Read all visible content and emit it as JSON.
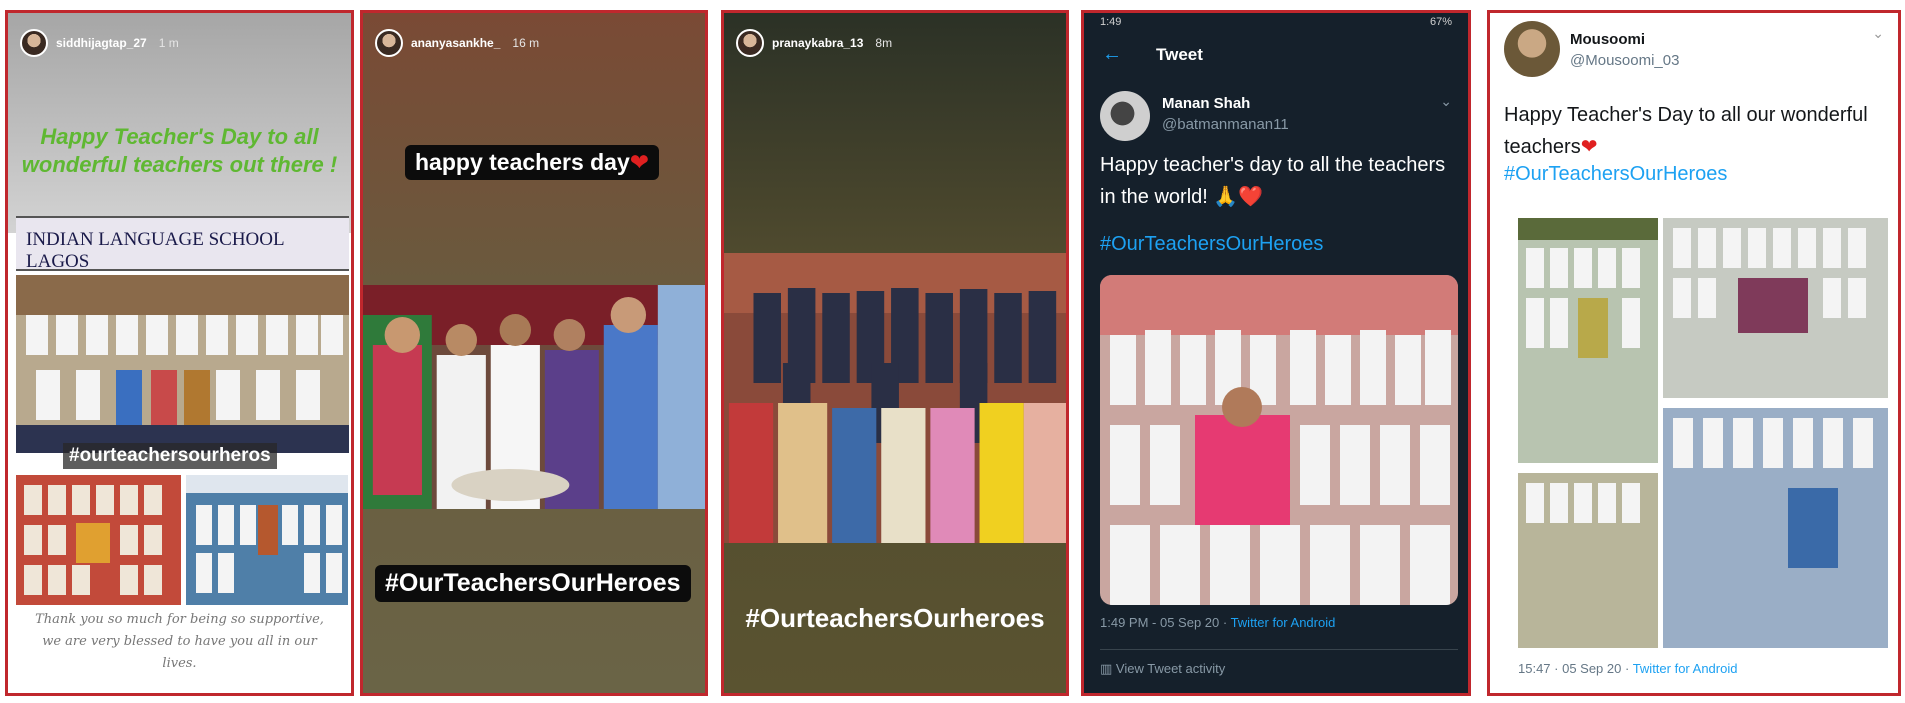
{
  "panel1": {
    "username": "siddhijagtap_27",
    "time": "1 m",
    "greeting": "Happy Teacher's Day to all wonderful teachers out there !",
    "sign": "INDIAN LANGUAGE SCHOOL LAGOS",
    "hashtag": "#ourteachersourheros",
    "thanks": "Thank you so much for being so supportive, we are very blessed to have you all in our lives."
  },
  "panel2": {
    "username": "ananyasankhe_",
    "time": "16 m",
    "sticker1": "happy teachers day",
    "hashtag": "#OurTeachersOurHeroes"
  },
  "panel3": {
    "username": "pranaykabra_13",
    "time": "8m",
    "hashtag": "#OurteachersOurheroes"
  },
  "panel4": {
    "status_time": "1:49",
    "status_battery": "67%",
    "nav_title": "Tweet",
    "name": "Manan Shah",
    "handle": "@batmanmanan11",
    "text": "Happy teacher's day to all the teachers in the world! 🙏❤️",
    "hashtag": "#OurTeachersOurHeroes",
    "meta_time": "1:49 PM - 05 Sep 20 · ",
    "meta_source": "Twitter for Android",
    "activity": "View Tweet activity"
  },
  "panel5": {
    "name": "Mousoomi",
    "handle": "@Mousoomi_03",
    "text": "Happy Teacher's Day to all our wonderful teachers",
    "hashtag": "#OurTeachersOurHeroes",
    "meta_time": "15:47 · 05 Sep 20 · ",
    "meta_source": "Twitter for Android"
  },
  "colors": {
    "frame": "#c0272d",
    "twitter_blue": "#1da1f2",
    "greeting_green": "#5fb832",
    "dark_bg": "#15202b"
  }
}
